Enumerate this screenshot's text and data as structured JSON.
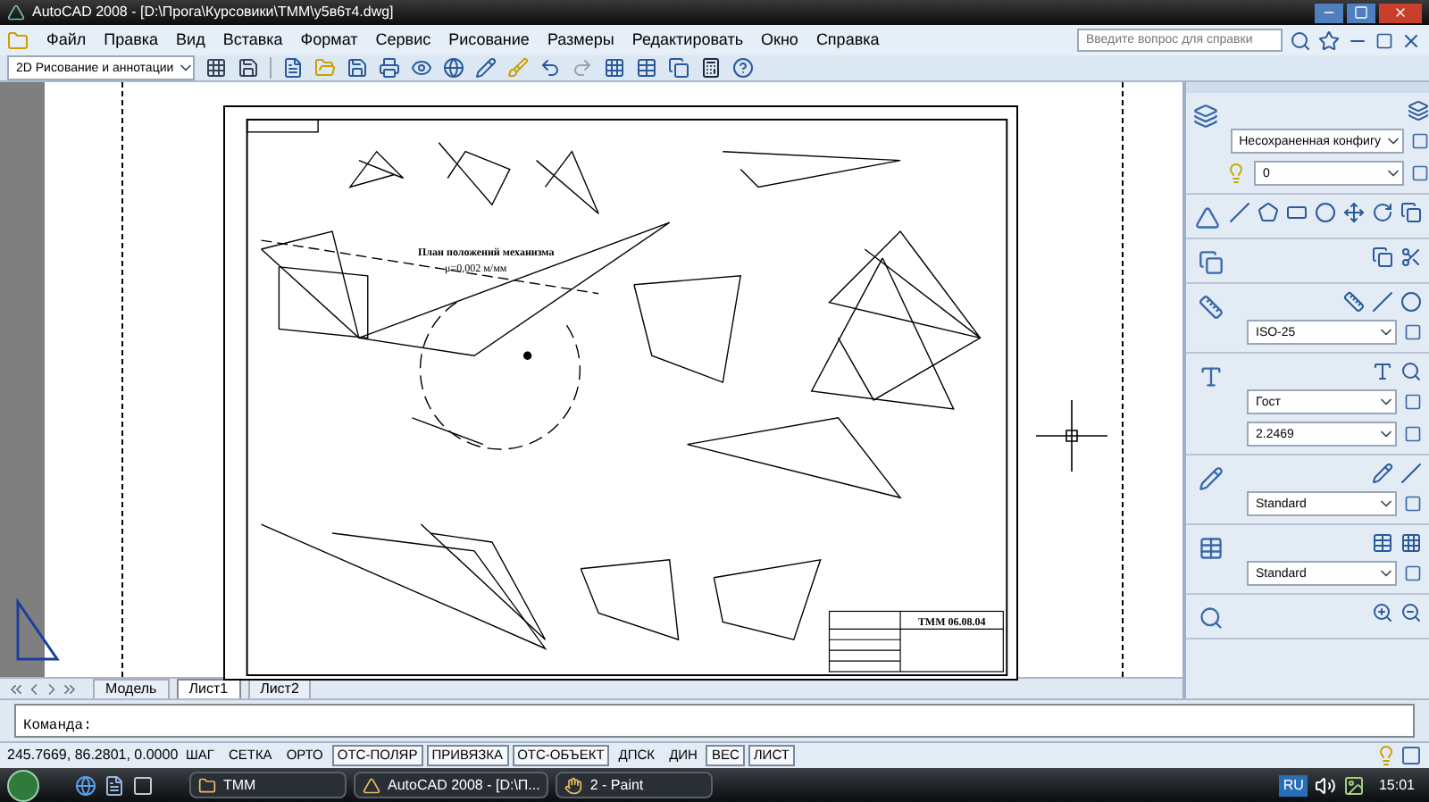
{
  "window": {
    "title": "AutoCAD 2008 - [D:\\Прога\\Курсовики\\ТММ\\у5в6т4.dwg]"
  },
  "menu": [
    "Файл",
    "Правка",
    "Вид",
    "Вставка",
    "Формат",
    "Сервис",
    "Рисование",
    "Размеры",
    "Редактировать",
    "Окно",
    "Справка"
  ],
  "help_search": {
    "placeholder": "Введите вопрос для справки"
  },
  "workspace": {
    "value": "2D Рисование и аннотации"
  },
  "drawing": {
    "plan_title": "План положений механизма",
    "plan_scale": "μ=0,002 м/мм",
    "title_block_code": "ТММ 06.08.04"
  },
  "palette_sections": [
    {
      "kind": "layers",
      "dropdowns": [
        "Несохраненная конфигу",
        "0"
      ]
    },
    {
      "kind": "draw"
    },
    {
      "kind": "blocks"
    },
    {
      "kind": "dimensions",
      "dropdowns": [
        "ISO-25"
      ]
    },
    {
      "kind": "text",
      "dropdowns": [
        "Гост",
        "2.2469"
      ]
    },
    {
      "kind": "leaders",
      "dropdowns": [
        "Standard"
      ]
    },
    {
      "kind": "tables",
      "dropdowns": [
        "Standard"
      ]
    },
    {
      "kind": "view"
    }
  ],
  "layout_tabs": [
    {
      "label": "Модель",
      "selected": false
    },
    {
      "label": "Лист1",
      "selected": true
    },
    {
      "label": "Лист2",
      "selected": false
    }
  ],
  "command": {
    "prompt": "Команда:"
  },
  "status_bar": {
    "coordinates": "245.7669, 86.2801, 0.0000",
    "toggles": [
      {
        "label": "ШАГ",
        "on": false
      },
      {
        "label": "СЕТКА",
        "on": false
      },
      {
        "label": "ОРТО",
        "on": false
      },
      {
        "label": "ОТС-ПОЛЯР",
        "on": true
      },
      {
        "label": "ПРИВЯЗКА",
        "on": true
      },
      {
        "label": "ОТС-ОБЪЕКТ",
        "on": true
      },
      {
        "label": "ДПСК",
        "on": false
      },
      {
        "label": "ДИН",
        "on": false
      },
      {
        "label": "ВЕС",
        "on": true
      },
      {
        "label": "ЛИСТ",
        "on": true
      }
    ]
  },
  "taskbar": {
    "windows": [
      {
        "label": "ТММ",
        "kind": "folder"
      },
      {
        "label": "AutoCAD 2008 - [D:\\П...",
        "kind": "autocad"
      },
      {
        "label": "2 - Paint",
        "kind": "paint"
      }
    ],
    "language": "RU",
    "clock": "15:01"
  }
}
